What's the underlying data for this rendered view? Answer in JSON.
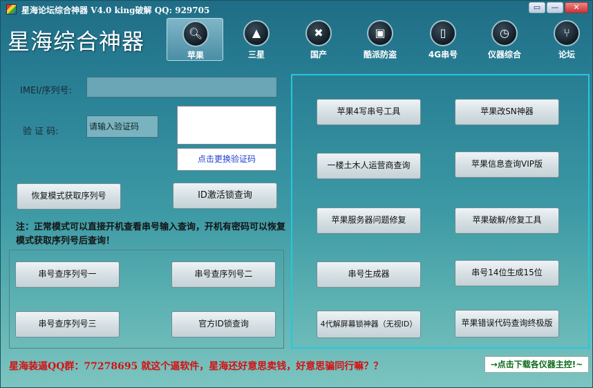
{
  "window": {
    "title": "星海论坛综合神器 V4.0  king破解  QQ: 929705",
    "controls": {
      "restore": "▭",
      "minimize": "—",
      "close": "✕"
    }
  },
  "app_title": "星海综合神器",
  "nav": [
    {
      "label": "苹果",
      "icon": "search-icon",
      "active": true
    },
    {
      "label": "三星",
      "icon": "flame-icon"
    },
    {
      "label": "国产",
      "icon": "tools-icon"
    },
    {
      "label": "酷派防盗",
      "icon": "cart-icon"
    },
    {
      "label": "4G串号",
      "icon": "phone-icon"
    },
    {
      "label": "仪器综合",
      "icon": "clock-icon"
    },
    {
      "label": "论坛",
      "icon": "share-icon"
    }
  ],
  "form": {
    "imei_label": "IMEI/序列号:",
    "captcha_label": "验 证 码:",
    "captcha_placeholder": "请输入验证码",
    "captcha_refresh": "点击更换验证码"
  },
  "buttons_left": {
    "recovery": "恢复模式获取序列号",
    "id_activation": "ID激活锁查询",
    "serial_1": "串号查序列号一",
    "serial_2": "串号查序列号二",
    "serial_3": "串号查序列号三",
    "official_id": "官方ID锁查询"
  },
  "note": "注：正常模式可以直接开机查看串号输入查询，开机有密码可以恢复模式获取序列号后查询！",
  "buttons_right": [
    "苹果4写串号工具",
    "苹果改SN神器",
    "一楼土木人运营商查询",
    "苹果信息查询VIP版",
    "苹果服务器问题修复",
    "苹果破解/修复工具",
    "串号生成器",
    "串号14位生成15位",
    "4代解屏幕锁神器（无视ID）",
    "苹果错误代码查询终极版"
  ],
  "footer": {
    "text": "星海装逼QQ群：77278695  就这个逼软件，星海还好意思卖钱，好意思骗同行嘛？？",
    "link": "→点击下载各仪器主控!~"
  }
}
